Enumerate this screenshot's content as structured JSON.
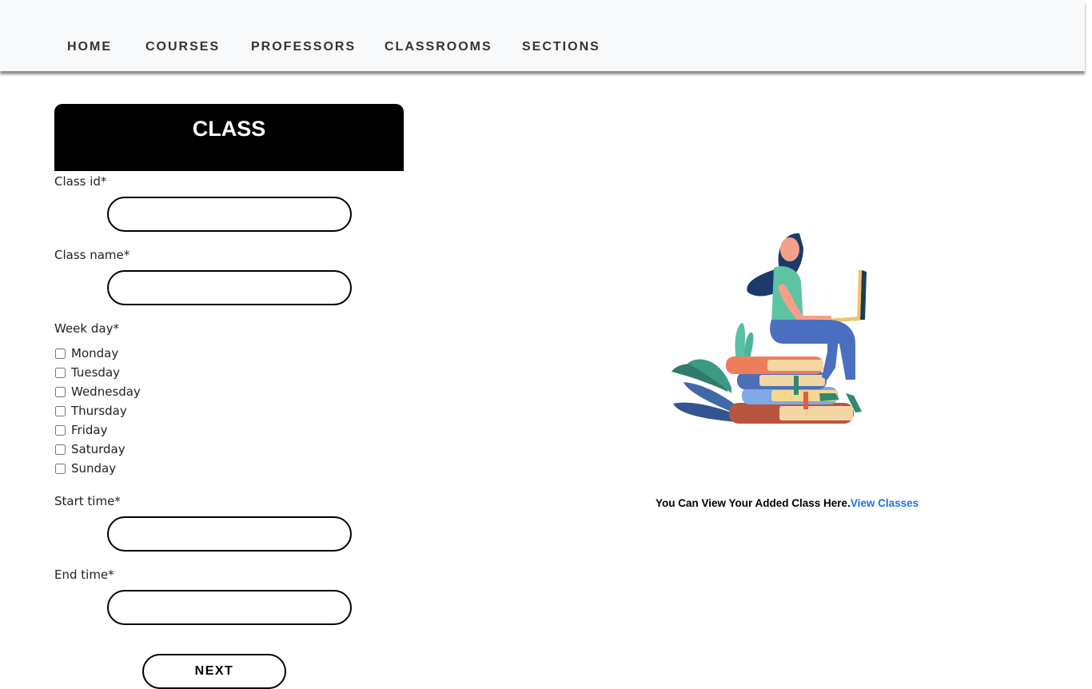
{
  "nav": {
    "items": [
      {
        "label": "HOME"
      },
      {
        "label": "COURSES"
      },
      {
        "label": "PROFESSORS"
      },
      {
        "label": "CLASSROOMS"
      },
      {
        "label": "SECTIONS"
      }
    ]
  },
  "form": {
    "title": "CLASS",
    "class_id_label": "Class id*",
    "class_id_value": "",
    "class_name_label": "Class name*",
    "class_name_value": "",
    "week_day_label": "Week day*",
    "days": [
      {
        "label": "Monday",
        "checked": false
      },
      {
        "label": "Tuesday",
        "checked": false
      },
      {
        "label": "Wednesday",
        "checked": false
      },
      {
        "label": "Thursday",
        "checked": false
      },
      {
        "label": "Friday",
        "checked": false
      },
      {
        "label": "Saturday",
        "checked": false
      },
      {
        "label": "Sunday",
        "checked": false
      }
    ],
    "start_time_label": "Start time*",
    "start_time_value": "",
    "end_time_label": "End time*",
    "end_time_value": "",
    "next_label": "NEXT"
  },
  "info": {
    "text": "You Can View Your Added Class Here.",
    "link_label": "View Classes"
  },
  "colors": {
    "header_bg": "#000000",
    "link": "#1a73e8",
    "navbar_bg": "#f8f9fa"
  },
  "illustration": {
    "icon": "woman-reading-on-books-illustration"
  }
}
